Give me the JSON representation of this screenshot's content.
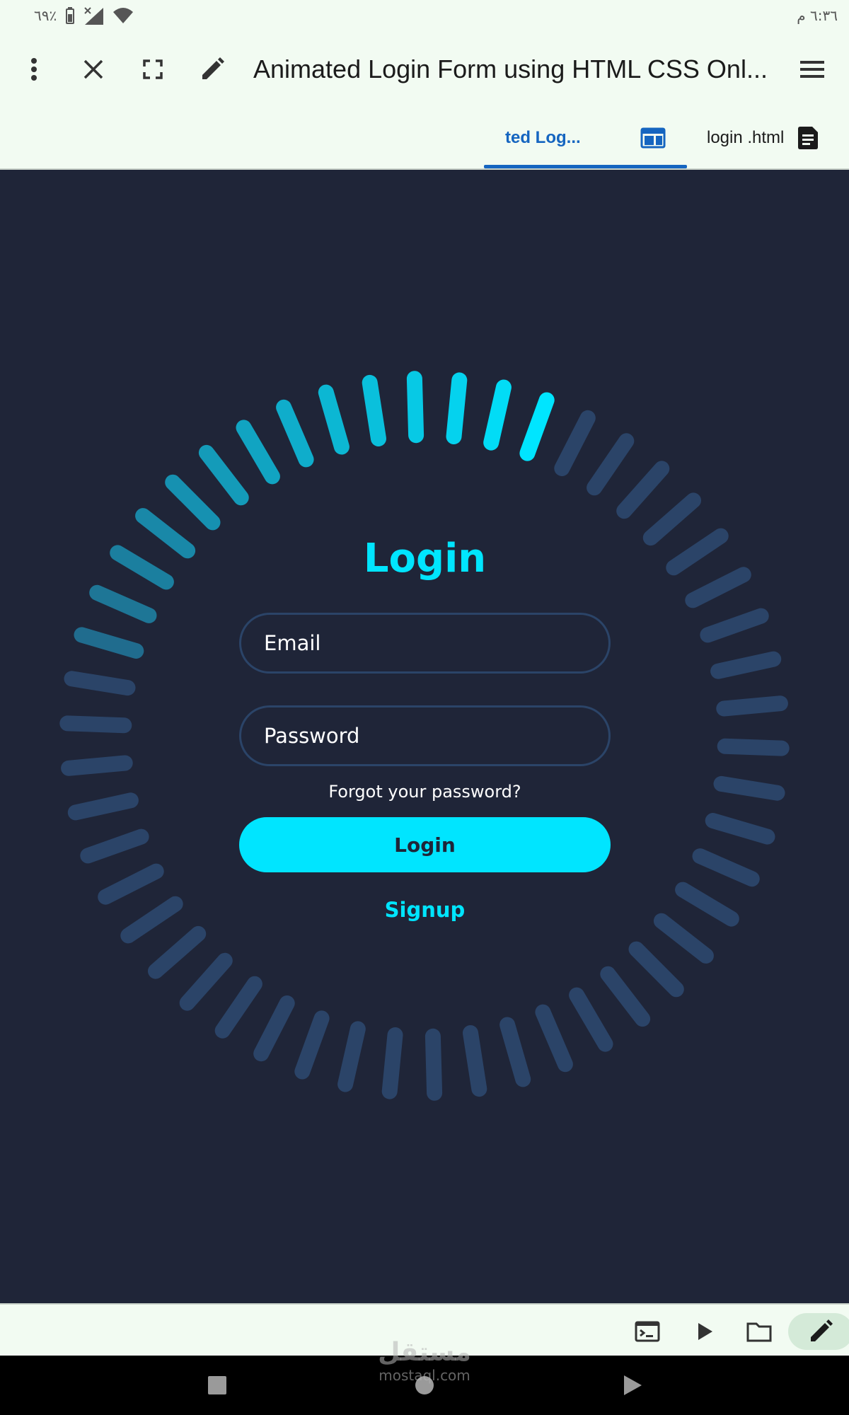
{
  "status_bar": {
    "battery": "٦٩٪",
    "time": "٦:٣٦ م"
  },
  "toolbar": {
    "title": "Animated Login Form using HTML CSS Onl..."
  },
  "tabs": [
    {
      "label": "ted Log..."
    },
    {
      "label": "login .html"
    }
  ],
  "form": {
    "title": "Login",
    "email_placeholder": "Email",
    "password_placeholder": "Password",
    "forgot_label": "Forgot your password?",
    "login_button": "Login",
    "signup_label": "Signup"
  },
  "ring": {
    "segment_count": 50,
    "highlighted_segments": 14,
    "colors": {
      "bright": "#00e5ff",
      "dim": "#2b4468",
      "background": "#1f2538"
    }
  },
  "icons": {
    "toolbar": [
      "more-vert-icon",
      "close-icon",
      "fullscreen-icon",
      "edit-icon",
      "menu-icon"
    ],
    "tabs": [
      "web-preview-icon",
      "document-icon"
    ],
    "bottom_bar": [
      "terminal-icon",
      "play-icon",
      "folder-icon",
      "edit-icon"
    ],
    "nav_bar": [
      "recents-square-icon",
      "home-circle-icon",
      "back-triangle-icon"
    ]
  },
  "watermark": {
    "arabic": "مستقل",
    "latin": "mostaql.com"
  }
}
